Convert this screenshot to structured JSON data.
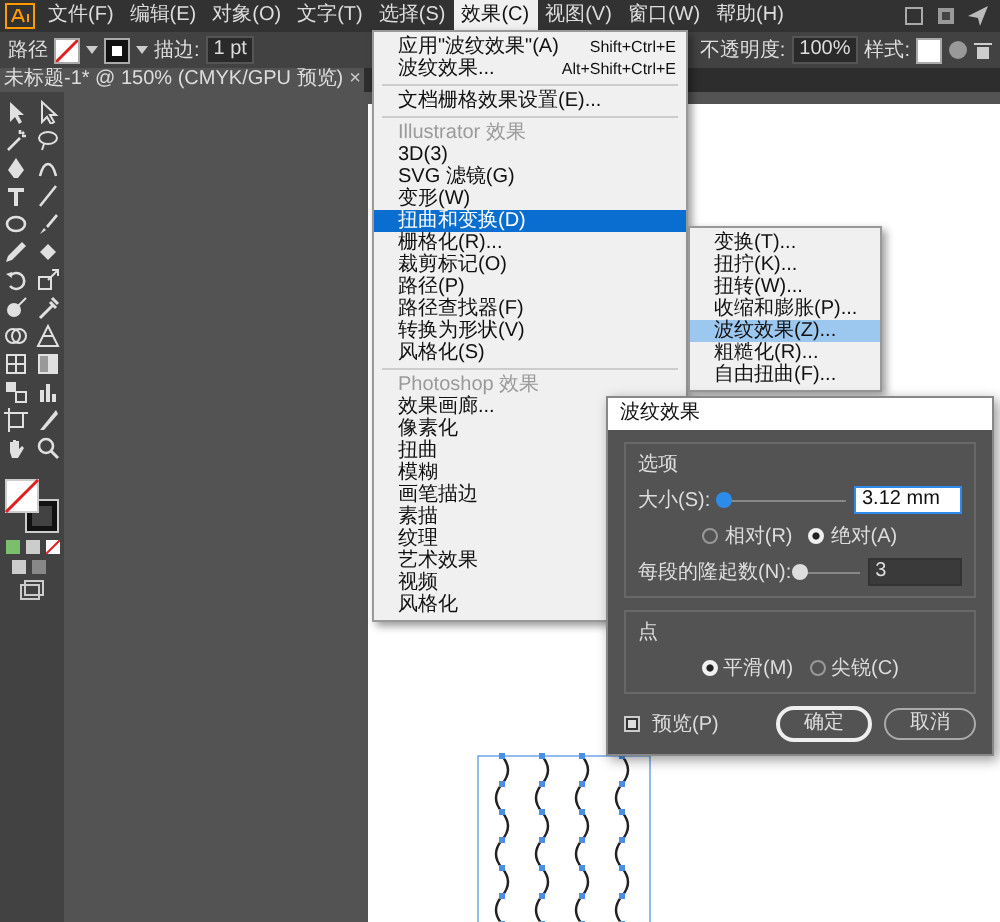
{
  "menubar": {
    "items": [
      {
        "label": "文件(F)",
        "selected": false
      },
      {
        "label": "编辑(E)",
        "selected": false
      },
      {
        "label": "对象(O)",
        "selected": false
      },
      {
        "label": "文字(T)",
        "selected": false
      },
      {
        "label": "选择(S)",
        "selected": false
      },
      {
        "label": "效果(C)",
        "selected": true
      },
      {
        "label": "视图(V)",
        "selected": false
      },
      {
        "label": "窗口(W)",
        "selected": false
      },
      {
        "label": "帮助(H)",
        "selected": false
      }
    ]
  },
  "control_bar": {
    "object_label": "路径",
    "stroke_label": "描边:",
    "stroke_weight": "1 pt",
    "opacity_label": "不透明度:",
    "opacity": "100%",
    "style_label": "样式:"
  },
  "document_tab": {
    "title": "未标题-1* @ 150% (CMYK/GPU 预览)",
    "close": "×"
  },
  "effect_menu": {
    "items": [
      {
        "kind": "item",
        "label": "应用\"波纹效果\"(A)",
        "shortcut": "Shift+Ctrl+E",
        "selected": false
      },
      {
        "kind": "item",
        "label": "波纹效果...",
        "shortcut": "Alt+Shift+Ctrl+E",
        "selected": false
      },
      {
        "kind": "separator"
      },
      {
        "kind": "item",
        "label": "文档栅格效果设置(E)...",
        "selected": false
      },
      {
        "kind": "separator"
      },
      {
        "kind": "header",
        "label": "Illustrator 效果"
      },
      {
        "kind": "item",
        "label": "3D(3)",
        "selected": false
      },
      {
        "kind": "item",
        "label": "SVG 滤镜(G)",
        "selected": false
      },
      {
        "kind": "item",
        "label": "变形(W)",
        "selected": false
      },
      {
        "kind": "item",
        "label": "扭曲和变换(D)",
        "selected": true
      },
      {
        "kind": "item",
        "label": "栅格化(R)...",
        "selected": false
      },
      {
        "kind": "item",
        "label": "裁剪标记(O)",
        "selected": false
      },
      {
        "kind": "item",
        "label": "路径(P)",
        "selected": false
      },
      {
        "kind": "item",
        "label": "路径查找器(F)",
        "selected": false
      },
      {
        "kind": "item",
        "label": "转换为形状(V)",
        "selected": false
      },
      {
        "kind": "item",
        "label": "风格化(S)",
        "selected": false
      },
      {
        "kind": "separator"
      },
      {
        "kind": "header",
        "label": "Photoshop 效果"
      },
      {
        "kind": "item",
        "label": "效果画廊...",
        "selected": false
      },
      {
        "kind": "item",
        "label": "像素化",
        "selected": false
      },
      {
        "kind": "item",
        "label": "扭曲",
        "selected": false
      },
      {
        "kind": "item",
        "label": "模糊",
        "selected": false
      },
      {
        "kind": "item",
        "label": "画笔描边",
        "selected": false
      },
      {
        "kind": "item",
        "label": "素描",
        "selected": false
      },
      {
        "kind": "item",
        "label": "纹理",
        "selected": false
      },
      {
        "kind": "item",
        "label": "艺术效果",
        "selected": false
      },
      {
        "kind": "item",
        "label": "视频",
        "selected": false
      },
      {
        "kind": "item",
        "label": "风格化",
        "selected": false
      }
    ]
  },
  "submenu": {
    "items": [
      {
        "label": "变换(T)...",
        "selected": false
      },
      {
        "label": "扭拧(K)...",
        "selected": false
      },
      {
        "label": "扭转(W)...",
        "selected": false
      },
      {
        "label": "收缩和膨胀(P)...",
        "selected": false
      },
      {
        "label": "波纹效果(Z)...",
        "selected": true
      },
      {
        "label": "粗糙化(R)...",
        "selected": false
      },
      {
        "label": "自由扭曲(F)...",
        "selected": false
      }
    ]
  },
  "dialog": {
    "title": "波纹效果",
    "groups": [
      {
        "title": "选项",
        "rows": [
          {
            "kind": "slider",
            "label": "大小(S):",
            "level": 0.05,
            "value": "3.12 mm",
            "focused": true
          },
          {
            "kind": "radios",
            "options": [
              {
                "label": "相对(R)",
                "selected": false
              },
              {
                "label": "绝对(A)",
                "selected": true
              }
            ]
          },
          {
            "kind": "slider",
            "label": "每段的隆起数(N):",
            "level": 0,
            "value": "3",
            "focused": false
          }
        ]
      },
      {
        "title": "点",
        "rows": [
          {
            "kind": "radios",
            "options": [
              {
                "label": "平滑(M)",
                "selected": true
              },
              {
                "label": "尖锐(C)",
                "selected": false
              }
            ]
          }
        ]
      }
    ],
    "preview": {
      "label": "预览(P)",
      "checked": true
    },
    "buttons": [
      {
        "label": "确定",
        "default": true
      },
      {
        "label": "取消",
        "default": false
      }
    ]
  }
}
